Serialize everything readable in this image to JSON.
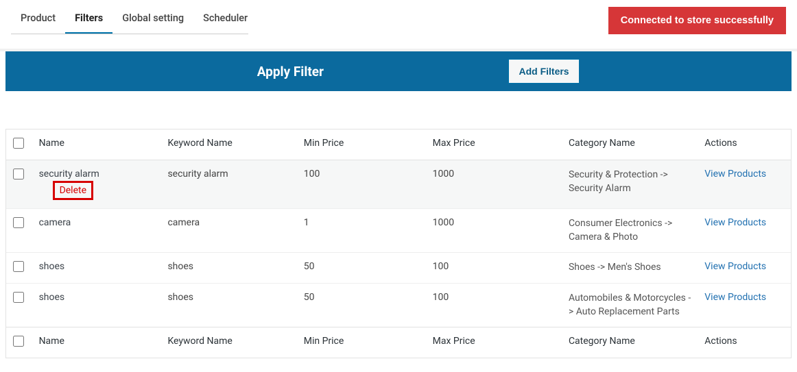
{
  "tabs": {
    "product": "Product",
    "filters": "Filters",
    "global": "Global setting",
    "scheduler": "Scheduler"
  },
  "status_button": "Connected to store successfully",
  "filter_bar": {
    "title": "Apply Filter",
    "add_button": "Add Filters"
  },
  "columns": {
    "name": "Name",
    "keyword": "Keyword Name",
    "min": "Min Price",
    "max": "Max Price",
    "category": "Category Name",
    "actions": "Actions"
  },
  "row_actions": {
    "delete": "Delete",
    "view": "View Products"
  },
  "rows": [
    {
      "name": "security alarm",
      "keyword": "security alarm",
      "min": "100",
      "max": "1000",
      "category": "Security & Protection -> Security Alarm",
      "show_delete": true
    },
    {
      "name": "camera",
      "keyword": "camera",
      "min": "1",
      "max": "1000",
      "category": "Consumer Electronics -> Camera & Photo",
      "show_delete": false
    },
    {
      "name": "shoes",
      "keyword": "shoes",
      "min": "50",
      "max": "100",
      "category": "Shoes -> Men's Shoes",
      "show_delete": false
    },
    {
      "name": "shoes",
      "keyword": "shoes",
      "min": "50",
      "max": "100",
      "category": "Automobiles & Motorcycles -> Auto Replacement Parts",
      "show_delete": false
    }
  ]
}
